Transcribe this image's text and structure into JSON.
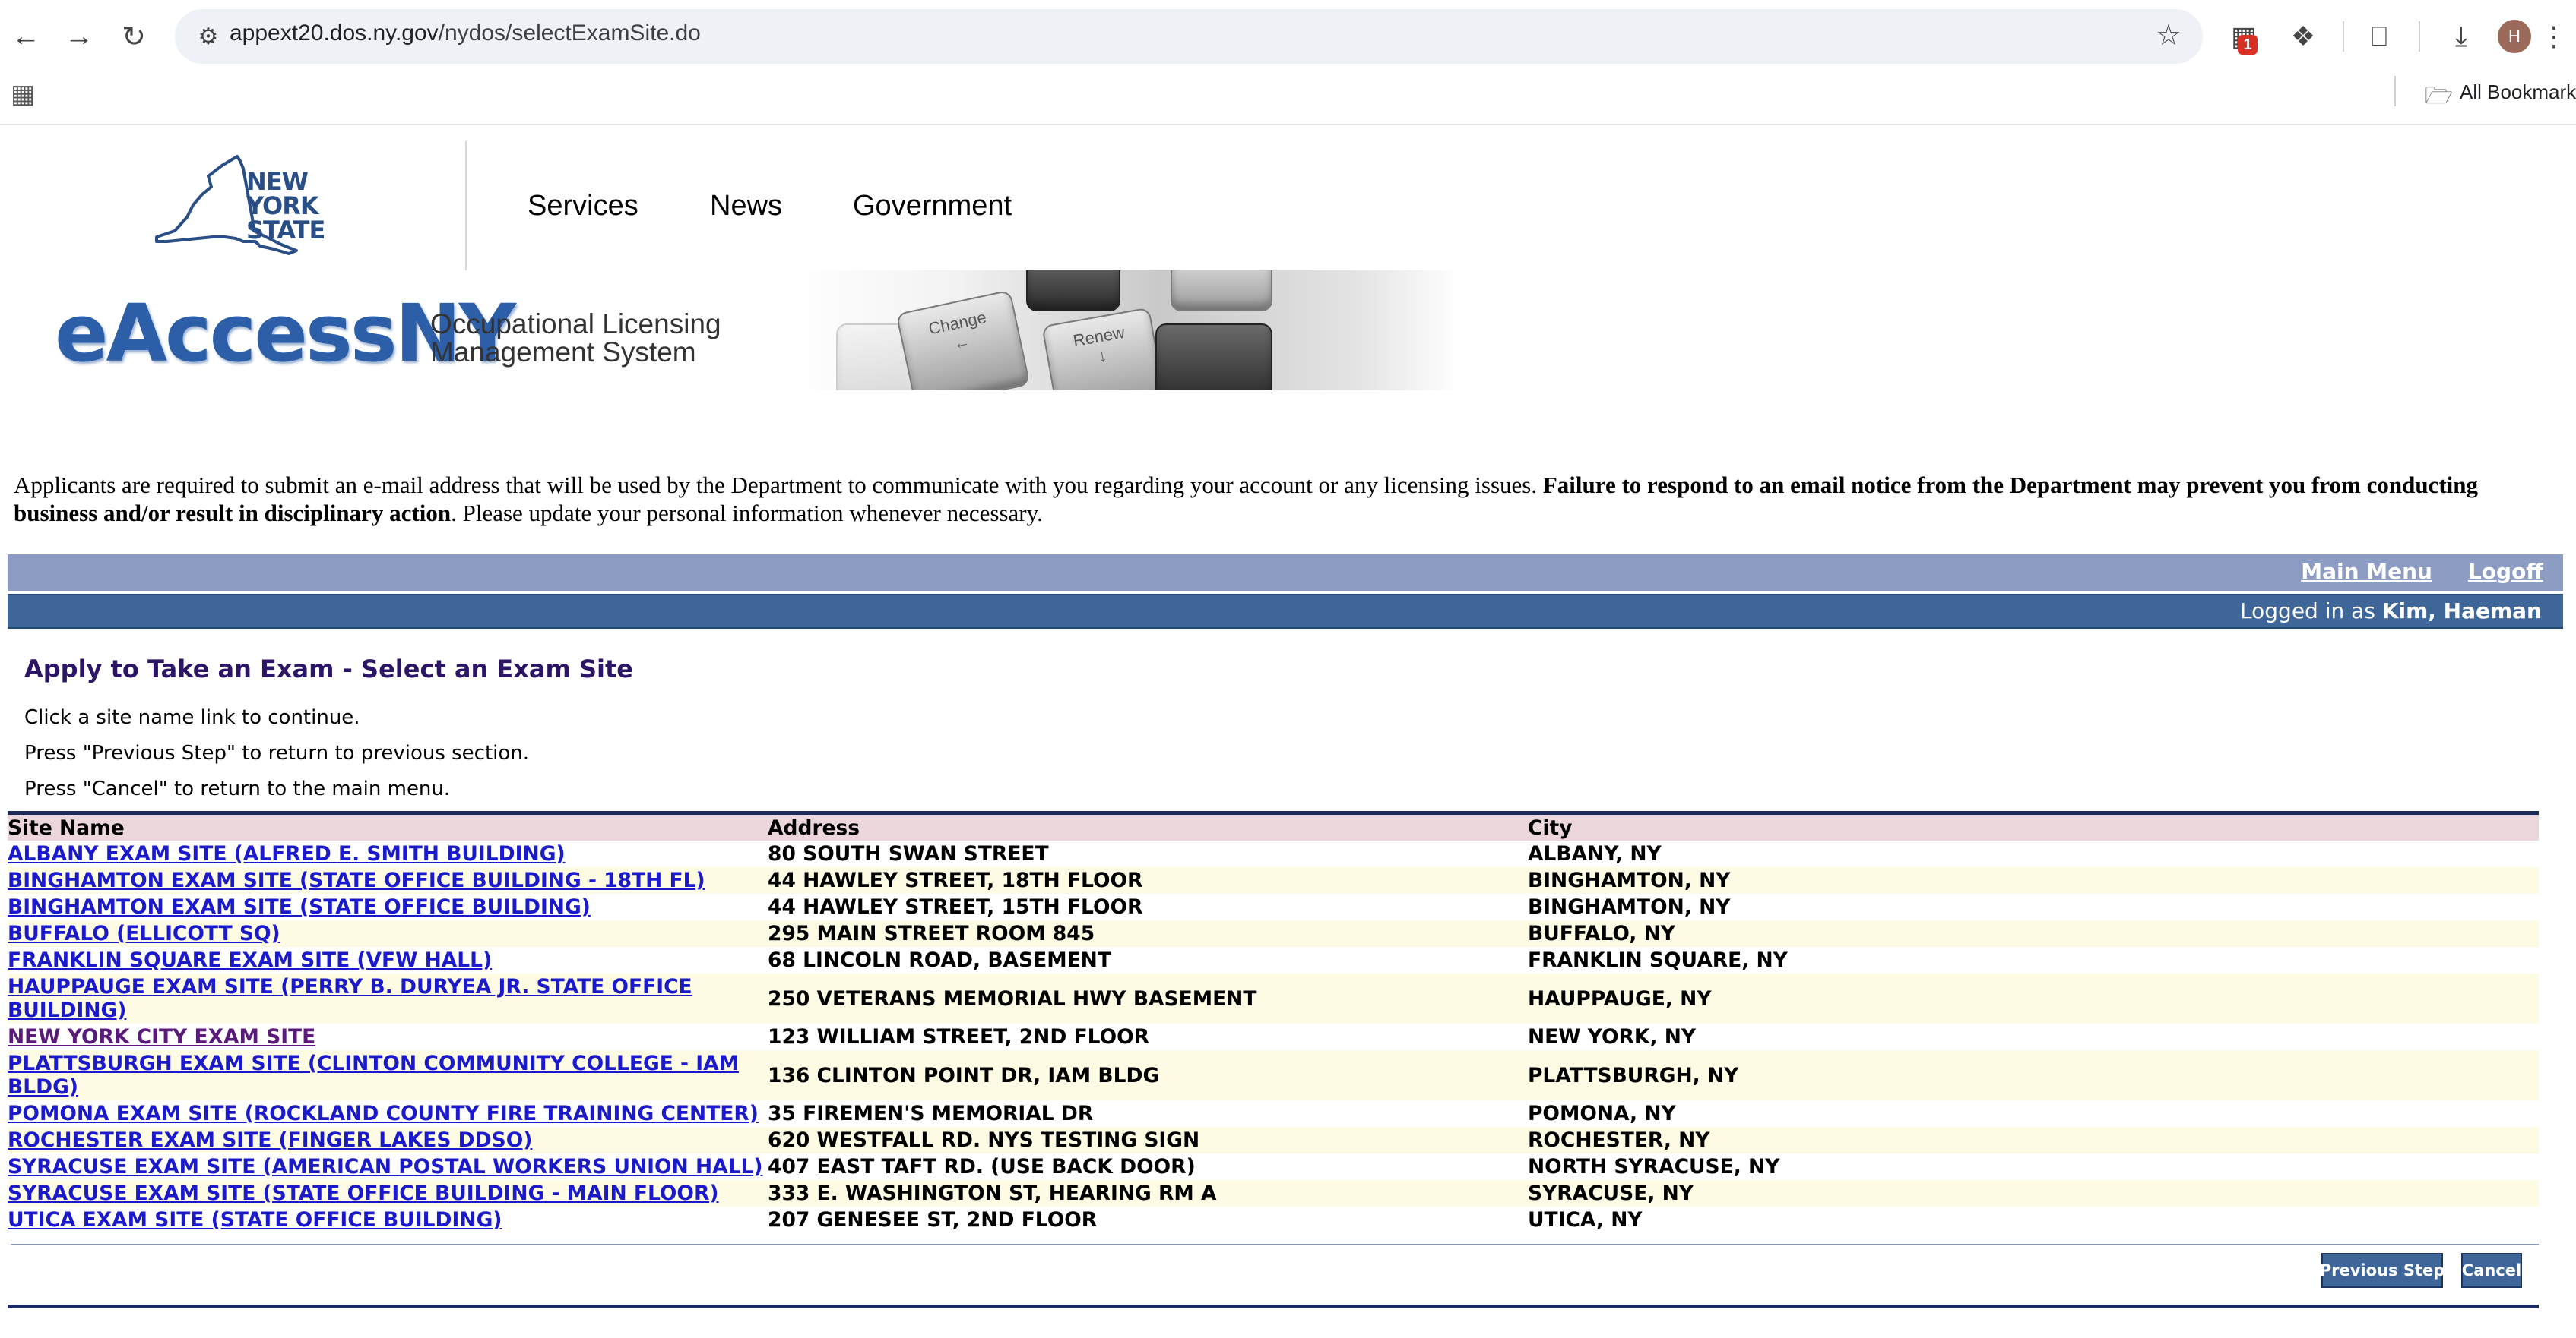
{
  "browser": {
    "url_host": "appext20.dos.ny.gov",
    "url_path": "/nydos/selectExamSite.do",
    "extension_badge": "1",
    "profile_initial": "H",
    "bookmarks_label": "All Bookmarks"
  },
  "header": {
    "logo_text": "NEW YORK STATE",
    "nav": [
      "Services",
      "News",
      "Government"
    ],
    "brand": "eAccessNY",
    "brand_sub_line1": "Occupational Licensing",
    "brand_sub_line2": "Management System",
    "key_labels": [
      "Change",
      "Renew"
    ]
  },
  "notice": {
    "part1": "Applicants are required to submit an e-mail address that will be used by the Department to communicate with you regarding your account or any licensing issues.",
    "bold": "Failure to respond to an email notice from the Department may prevent you from conducting business and/or result in disciplinary action",
    "part2": ". Please update your personal information whenever necessary."
  },
  "menu": {
    "main_menu": "Main Menu",
    "logoff": "Logoff",
    "logged_in_prefix": "Logged in as",
    "user": "Kim, Haeman"
  },
  "page": {
    "title": "Apply to Take an Exam - Select an Exam Site",
    "instructions": [
      "Click a site name link to continue.",
      "Press \"Previous Step\" to return to previous section.",
      "Press \"Cancel\" to return to the main menu."
    ]
  },
  "table": {
    "headers": [
      "Site Name",
      "Address",
      "City"
    ],
    "rows": [
      {
        "site": "ALBANY EXAM SITE (ALFRED E. SMITH BUILDING)",
        "address": "80 SOUTH SWAN STREET",
        "city": "ALBANY, NY"
      },
      {
        "site": "BINGHAMTON EXAM SITE (STATE OFFICE BUILDING - 18TH FL)",
        "address": "44 HAWLEY STREET, 18TH FLOOR",
        "city": "BINGHAMTON, NY"
      },
      {
        "site": "BINGHAMTON EXAM SITE (STATE OFFICE BUILDING)",
        "address": "44 HAWLEY STREET, 15TH FLOOR",
        "city": "BINGHAMTON, NY"
      },
      {
        "site": "BUFFALO (ELLICOTT SQ)",
        "address": "295 MAIN STREET ROOM 845",
        "city": "BUFFALO, NY"
      },
      {
        "site": "FRANKLIN SQUARE EXAM SITE (VFW HALL)",
        "address": "68 LINCOLN ROAD, BASEMENT",
        "city": "FRANKLIN SQUARE, NY"
      },
      {
        "site": "HAUPPAUGE EXAM SITE (PERRY B. DURYEA JR. STATE OFFICE BUILDING)",
        "address": "250 VETERANS MEMORIAL HWY BASEMENT",
        "city": "HAUPPAUGE, NY"
      },
      {
        "site": "NEW YORK CITY EXAM SITE",
        "address": "123 WILLIAM STREET, 2ND FLOOR",
        "city": "NEW YORK, NY"
      },
      {
        "site": "PLATTSBURGH EXAM SITE (CLINTON COMMUNITY COLLEGE - IAM BLDG)",
        "address": "136 CLINTON POINT DR, IAM BLDG",
        "city": "PLATTSBURGH, NY"
      },
      {
        "site": "POMONA EXAM SITE (ROCKLAND COUNTY FIRE TRAINING CENTER)",
        "address": "35 FIREMEN'S MEMORIAL DR",
        "city": "POMONA, NY"
      },
      {
        "site": "ROCHESTER EXAM SITE (FINGER LAKES DDSO)",
        "address": "620 WESTFALL RD. NYS TESTING SIGN",
        "city": "ROCHESTER, NY"
      },
      {
        "site": "SYRACUSE EXAM SITE (AMERICAN POSTAL WORKERS UNION HALL)",
        "address": "407 EAST TAFT RD. (USE BACK DOOR)",
        "city": "NORTH SYRACUSE, NY"
      },
      {
        "site": "SYRACUSE EXAM SITE (STATE OFFICE BUILDING - MAIN FLOOR)",
        "address": "333 E. WASHINGTON ST, HEARING RM A",
        "city": "SYRACUSE, NY"
      },
      {
        "site": "UTICA EXAM SITE (STATE OFFICE BUILDING)",
        "address": "207 GENESEE ST, 2ND FLOOR",
        "city": "UTICA, NY"
      }
    ]
  },
  "buttons": {
    "previous_step": "Previous Step",
    "cancel": "Cancel"
  }
}
